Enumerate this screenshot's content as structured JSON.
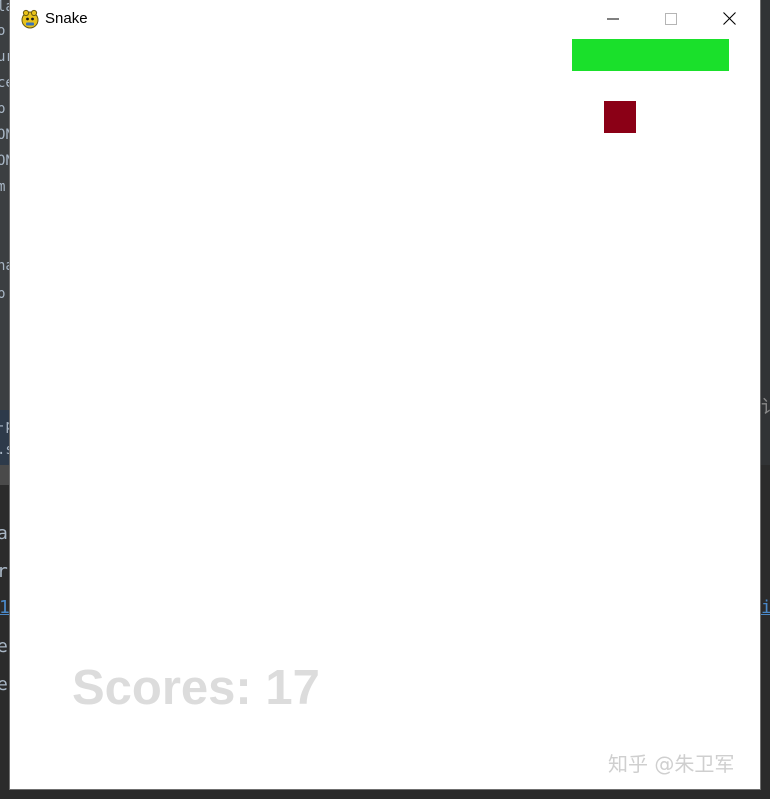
{
  "window": {
    "title": "Snake",
    "icon": "pygame-snake-icon",
    "controls": {
      "minimize_icon": "minimize-icon",
      "maximize_icon": "maximize-icon",
      "close_icon": "close-icon"
    }
  },
  "game": {
    "score_text": "Scores: 17",
    "snake_color": "#1ae02b",
    "food_color": "#8b0016",
    "score_color": "#dcdcdc",
    "background_color": "#ffffff"
  },
  "watermark": {
    "text": "知乎 @朱卫军"
  },
  "background": {
    "left_fragments": [
      "la",
      "o",
      "ur",
      "ce",
      "p",
      "ON",
      "ON",
      "m",
      "na",
      "p",
      "-p",
      ".s",
      "a",
      "ra",
      "1",
      "e",
      "e"
    ],
    "right_fragments": [
      "讠",
      "i"
    ]
  }
}
